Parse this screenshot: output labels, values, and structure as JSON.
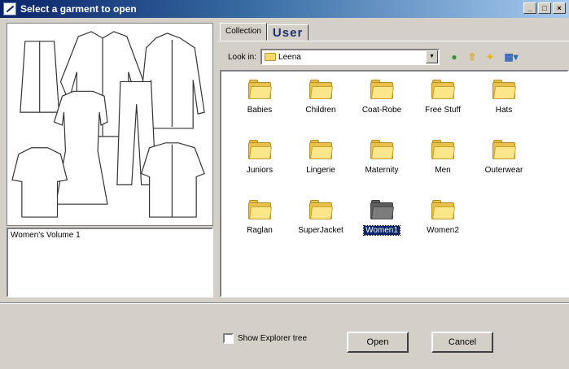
{
  "window": {
    "title": "Select a garment to open",
    "controls": {
      "minimize": "_",
      "maximize": "□",
      "close": "×"
    }
  },
  "preview": {
    "description": "Women's Volume 1"
  },
  "tabs": [
    {
      "label": "Collection",
      "active": true
    },
    {
      "label": "User",
      "active": false
    }
  ],
  "lookin": {
    "label": "Look in:",
    "value": "Leena",
    "arrow": "▼"
  },
  "nav_icons": [
    {
      "name": "back-icon",
      "glyph": "●",
      "color": "#2c9a2c"
    },
    {
      "name": "up-folder-icon",
      "glyph": "⇧",
      "color": "#d8a516"
    },
    {
      "name": "new-folder-icon",
      "glyph": "✦",
      "color": "#e5b820"
    },
    {
      "name": "view-menu-icon",
      "glyph": "▦▾",
      "color": "#3566b8"
    }
  ],
  "files": [
    {
      "label": "Babies",
      "selected": false
    },
    {
      "label": "Children",
      "selected": false
    },
    {
      "label": "Coat-Robe",
      "selected": false
    },
    {
      "label": "Free Stuff",
      "selected": false
    },
    {
      "label": "Hats",
      "selected": false
    },
    {
      "label": "Juniors",
      "selected": false
    },
    {
      "label": "Lingerie",
      "selected": false
    },
    {
      "label": "Maternity",
      "selected": false
    },
    {
      "label": "Men",
      "selected": false
    },
    {
      "label": "Outerwear",
      "selected": false
    },
    {
      "label": "Raglan",
      "selected": false
    },
    {
      "label": "SuperJacket",
      "selected": false
    },
    {
      "label": "Women1",
      "selected": true
    },
    {
      "label": "Women2",
      "selected": false
    }
  ],
  "footer": {
    "show_tree_label": "Show Explorer tree",
    "show_tree_checked": false,
    "open_label": "Open",
    "cancel_label": "Cancel"
  }
}
